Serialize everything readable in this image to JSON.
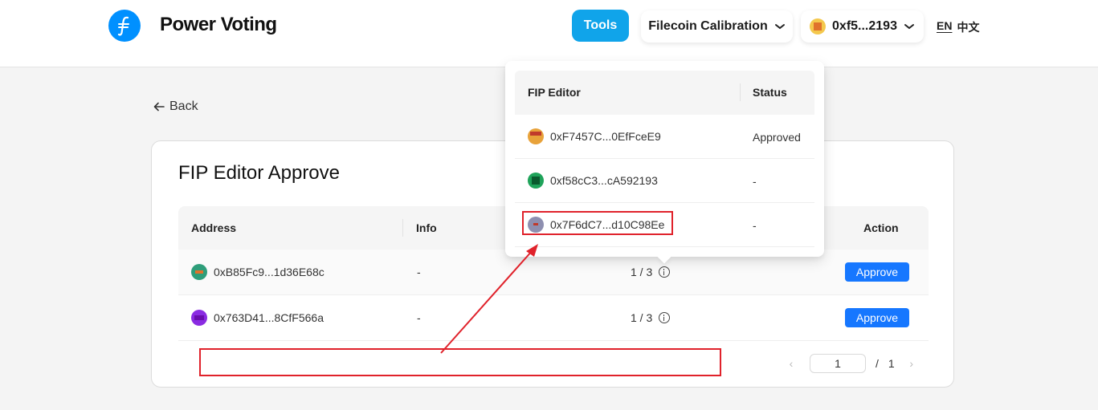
{
  "header": {
    "app_title": "Power Voting",
    "tools_label": "Tools",
    "network_label": "Filecoin Calibration",
    "wallet_label": "0xf5...2193",
    "lang_en": "EN",
    "lang_zh": "中文"
  },
  "back_label": "Back",
  "page_title": "FIP Editor Approve",
  "table": {
    "columns": [
      "Address",
      "Info",
      "",
      "Action"
    ],
    "rows": [
      {
        "address": "0xB85Fc9...1d36E68c",
        "info": "-",
        "votes": "1 / 3",
        "action": "Approve"
      },
      {
        "address": "0x763D41...8CfF566a",
        "info": "-",
        "votes": "1 / 3",
        "action": "Approve"
      }
    ]
  },
  "pagination": {
    "current": "1",
    "separator": "/",
    "total": "1"
  },
  "popover": {
    "columns": [
      "FIP Editor",
      "Status"
    ],
    "rows": [
      {
        "address": "0xF7457C...0EfFceE9",
        "status": "Approved"
      },
      {
        "address": "0xf58cC3...cA592193",
        "status": "-"
      },
      {
        "address": "0x7F6dC7...d10C98Ee",
        "status": "-"
      }
    ]
  },
  "colors": {
    "brand": "#0090ff",
    "tools": "#10a4ea",
    "approve": "#1677ff",
    "annotation": "#e0222b"
  }
}
